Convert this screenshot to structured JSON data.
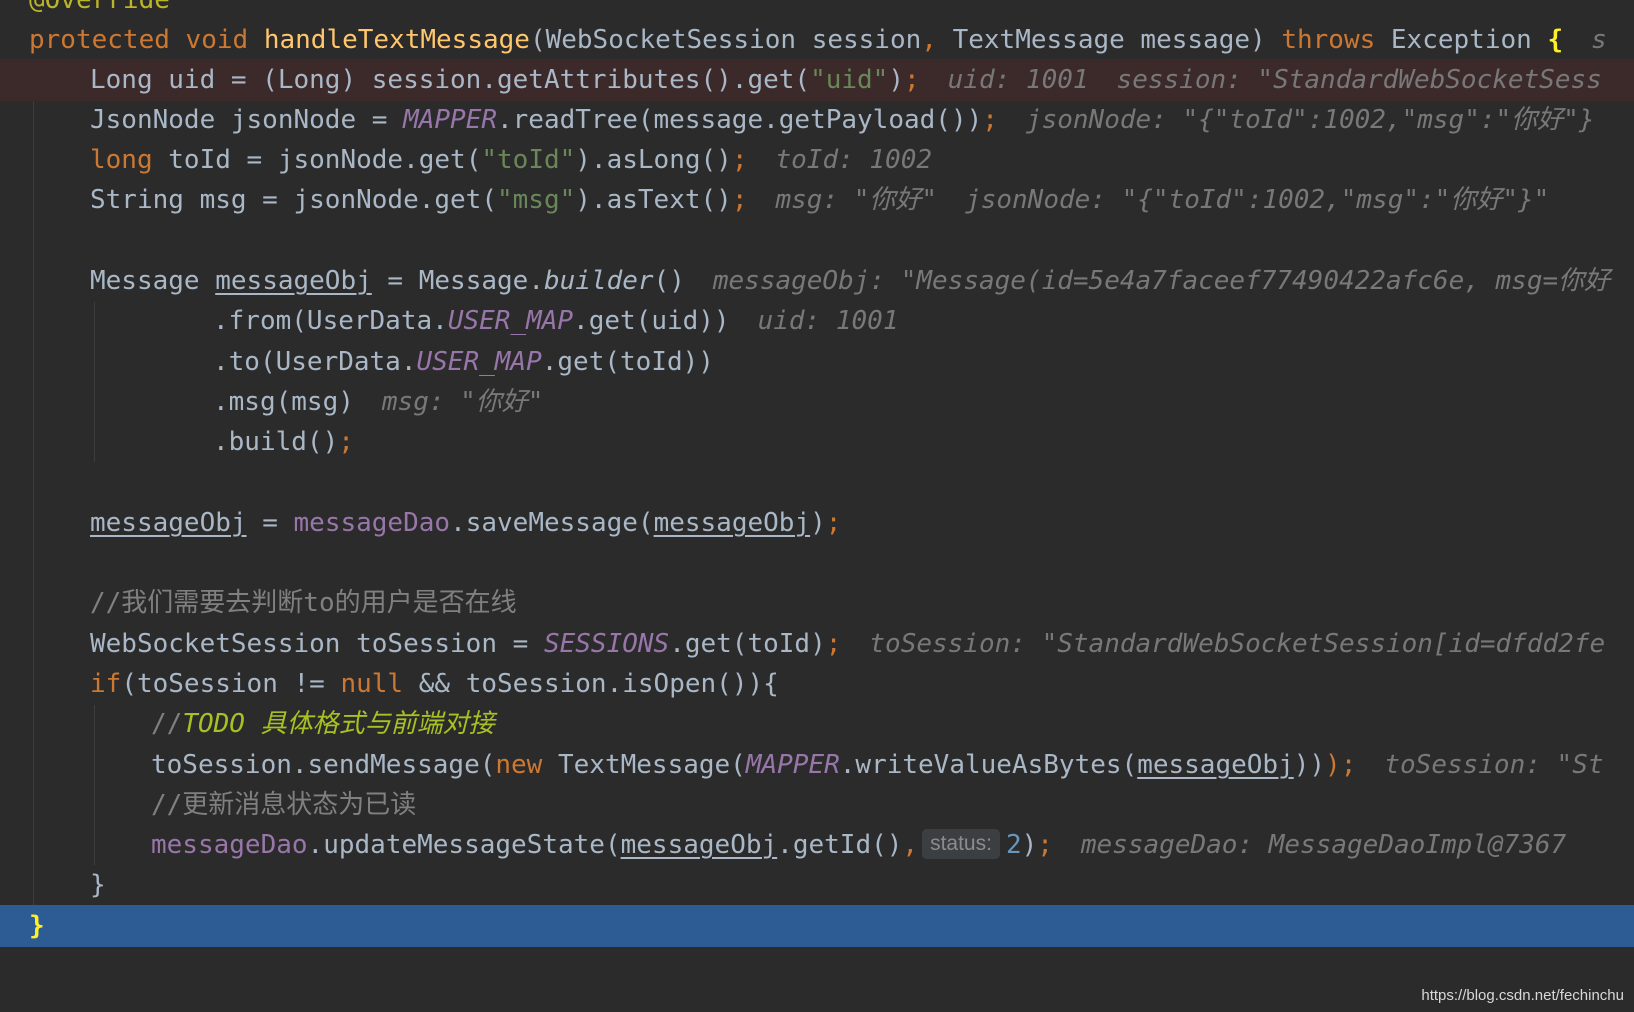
{
  "editor": {
    "theme": "darcula",
    "colors": {
      "background": "#2b2b2b",
      "keyword": "#cc7832",
      "method_decl": "#ffc66d",
      "string": "#6a8759",
      "number": "#6897bb",
      "field": "#9876aa",
      "comment": "#808080",
      "todo": "#a8c023",
      "current_line": "#2d5b94",
      "error_line": "#3c2a2a"
    },
    "lines": {
      "l0": {
        "annotation": "@Override"
      },
      "l1": {
        "kw_protected": "protected",
        "kw_void": "void",
        "method": "handleTextMessage",
        "params_open": "(WebSocketSession session",
        "comma": ",",
        "params_rest": " TextMessage message)",
        "kw_throws": "throws",
        "exception": " Exception ",
        "brace": "{",
        "hint": "s"
      },
      "l2": {
        "t1": "Long uid = (Long) session.getAttributes().get(",
        "str_uid": "\"uid\"",
        "t2": ")",
        "semi": ";",
        "hint1": "uid: 1001",
        "hint2": "session: \"StandardWebSocketSess"
      },
      "l3": {
        "t1": "JsonNode jsonNode = ",
        "mapper": "MAPPER",
        "t2": ".readTree(message.getPayload())",
        "semi": ";",
        "hint": "jsonNode: \"{\"toId\":1002,\"msg\":\"你好\"}"
      },
      "l4": {
        "kw_long": "long",
        "t1": " toId = jsonNode.get(",
        "str_toid": "\"toId\"",
        "t2": ").asLong()",
        "semi": ";",
        "hint": "toId: 1002"
      },
      "l5": {
        "t1": "String msg = jsonNode.get(",
        "str_msg": "\"msg\"",
        "t2": ").asText()",
        "semi": ";",
        "hint1": "msg: \"你好\"",
        "hint2": "jsonNode: \"{\"toId\":1002,\"msg\":\"你好\"}\""
      },
      "l7": {
        "t1": "Message ",
        "var": "messageObj",
        "t2": " = Message.",
        "builder": "builder",
        "t3": "()",
        "hint": "messageObj: \"Message(id=5e4a7faceef77490422afc6e, msg=你好"
      },
      "l8": {
        "t1": ".from(UserData.",
        "usermap": "USER_MAP",
        "t2": ".get(uid))",
        "hint": "uid: 1001"
      },
      "l9": {
        "t1": ".to(UserData.",
        "usermap": "USER_MAP",
        "t2": ".get(toId))"
      },
      "l10": {
        "t1": ".msg(msg)",
        "hint": "msg: \"你好\""
      },
      "l11": {
        "t1": ".build()",
        "semi": ";"
      },
      "l13": {
        "var1": "messageObj",
        "t1": " = ",
        "dao": "messageDao",
        "t2": ".saveMessage(",
        "var2": "messageObj",
        "t3": ")",
        "semi": ";"
      },
      "l15": {
        "comment": "//我们需要去判断to的用户是否在线"
      },
      "l16": {
        "t1": "WebSocketSession toSession = ",
        "sessions": "SESSIONS",
        "t2": ".get(toId)",
        "semi": ";",
        "hint": "toSession: \"StandardWebSocketSession[id=dfdd2fe"
      },
      "l17": {
        "kw_if": "if",
        "t1": "(toSession != ",
        "kw_null": "null",
        "t2": " && toSession.isOpen()){"
      },
      "l18": {
        "slashes": "//",
        "todo": "TODO 具体格式与前端对接"
      },
      "l19": {
        "t1": "toSession.sendMessage(",
        "kw_new": "new",
        "t2": " TextMessage(",
        "mapper": "MAPPER",
        "t3": ".writeValueAsBytes(",
        "var": "messageObj",
        "t4": "))",
        "semi": ");",
        "hint": "toSession: \"St"
      },
      "l20": {
        "comment": "//更新消息状态为已读"
      },
      "l21": {
        "dao": "messageDao",
        "t1": ".updateMessageState(",
        "var": "messageObj",
        "t2": ".getId()",
        "comma": ",",
        "inlay": "status:",
        "num": "2",
        "t3": ")",
        "semi": ";",
        "hint": "messageDao: MessageDaoImpl@7367"
      },
      "l22": {
        "brace": "}"
      },
      "l23": {
        "brace": "}"
      }
    },
    "watermark": "https://blog.csdn.net/fechinchu"
  }
}
